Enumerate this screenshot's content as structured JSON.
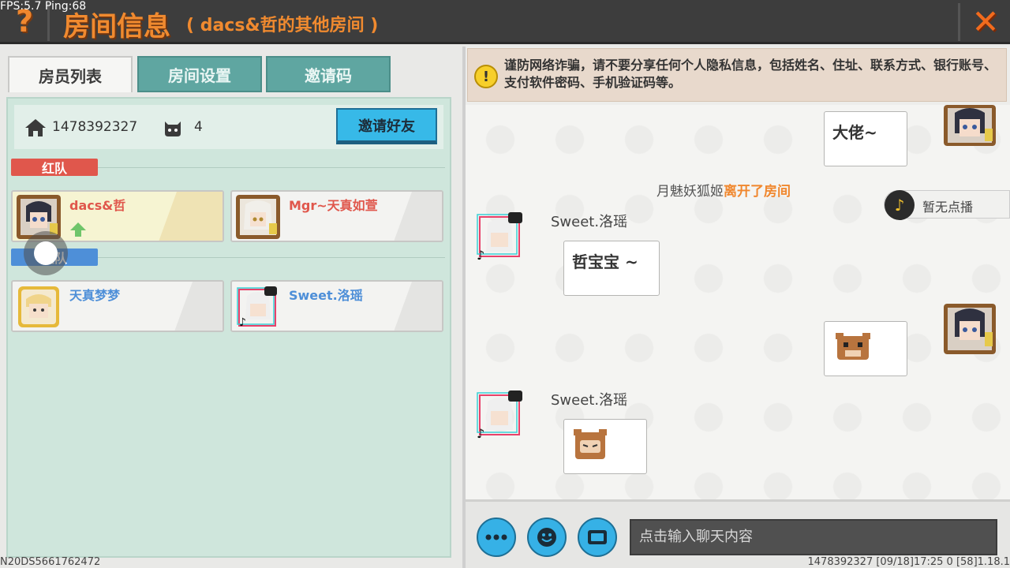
{
  "debug": {
    "fps": "FPS:5.7  Ping:68",
    "device_id": "N20DS5661762472",
    "footer": "1478392327    [09/18]17:25 0    [58]1.18.1"
  },
  "header": {
    "help": "?",
    "title": "房间信息",
    "subtitle": "( dacs&哲的其他房间 )",
    "close": "✕"
  },
  "tabs": [
    {
      "label": "房员列表",
      "active": true
    },
    {
      "label": "房间设置",
      "active": false
    },
    {
      "label": "邀请码",
      "active": false
    }
  ],
  "room": {
    "id": "1478392327",
    "player_count": "4",
    "invite_label": "邀请好友"
  },
  "teams": {
    "red": {
      "label": "红队",
      "members": [
        "dacs&哲",
        "Mgr~天真如萱"
      ]
    },
    "blue": {
      "label": "蓝队",
      "members": [
        "天真梦梦",
        "Sweet.洛瑶"
      ]
    }
  },
  "colors": {
    "accent": "#f08a2f",
    "red_team": "#e0574c",
    "blue_team": "#4e8fd8",
    "invite_btn": "#37b9e8"
  },
  "warning": {
    "text": "谨防网络诈骗，请不要分享任何个人隐私信息，包括姓名、住址、联系方式、银行账号、支付软件密码、手机验证码等。"
  },
  "chat": {
    "msg1": "大佬~",
    "system_user": "月魅妖狐姬",
    "system_action": "离开了房间",
    "sender2": "Sweet.洛瑶",
    "msg2": "哲宝宝 ~",
    "sender3": "Sweet.洛瑶"
  },
  "music": {
    "label": "暂无点播"
  },
  "input": {
    "placeholder": "点击输入聊天内容"
  }
}
